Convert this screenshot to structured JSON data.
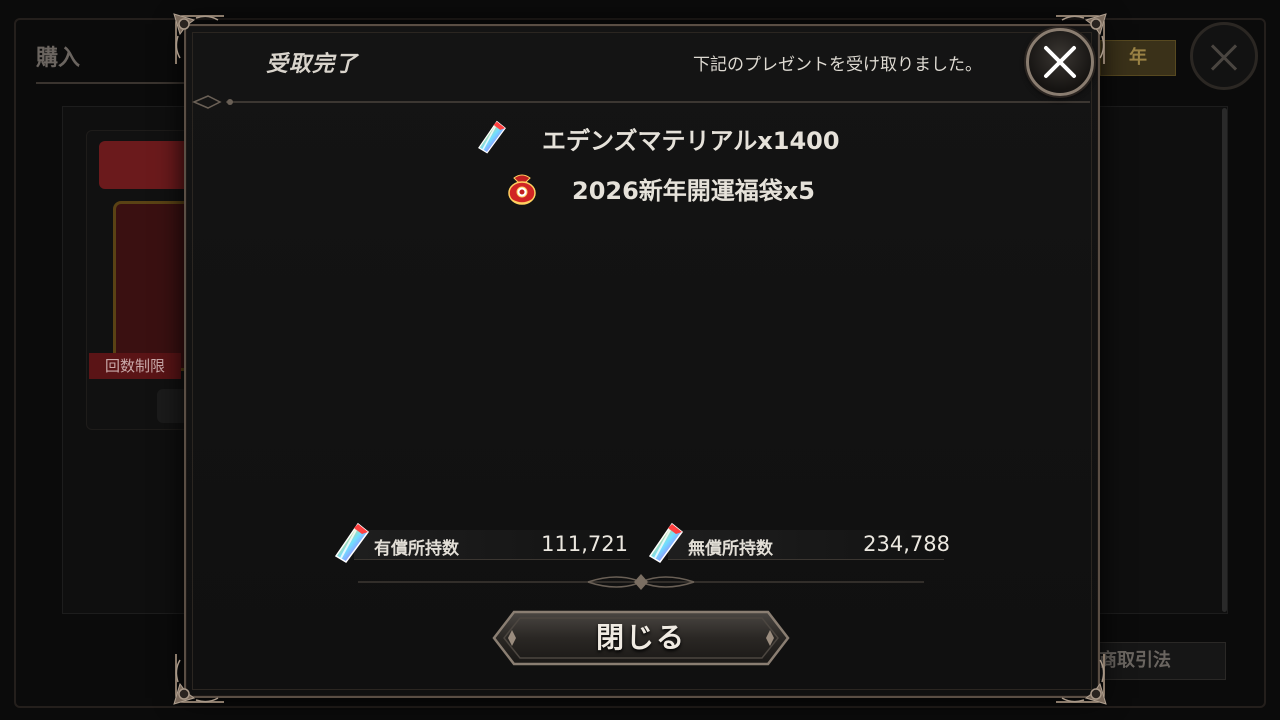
{
  "background": {
    "title": "購入",
    "tab_label": "年",
    "card_stock_label": "回数制限",
    "legal_button": "商取引法"
  },
  "modal": {
    "title": "受取完了",
    "message": "下記のプレゼントを受け取りました。",
    "rewards": [
      {
        "icon": "crystal-icon",
        "label": "エデンズマテリアルx1400"
      },
      {
        "icon": "lucky-bag-icon",
        "label": "2026新年開運福袋x5"
      }
    ],
    "currencies": {
      "paid": {
        "icon": "crystal-icon",
        "label": "有償所持数",
        "value": "111,721"
      },
      "free": {
        "icon": "crystal-icon",
        "label": "無償所持数",
        "value": "234,788"
      }
    },
    "close_button": "閉じる"
  },
  "colors": {
    "frame": "#5a4e44",
    "panel": "#121212",
    "text": "#e6e2da",
    "ribbon_red": "#6b1a1c",
    "gold": "#9a8245"
  }
}
